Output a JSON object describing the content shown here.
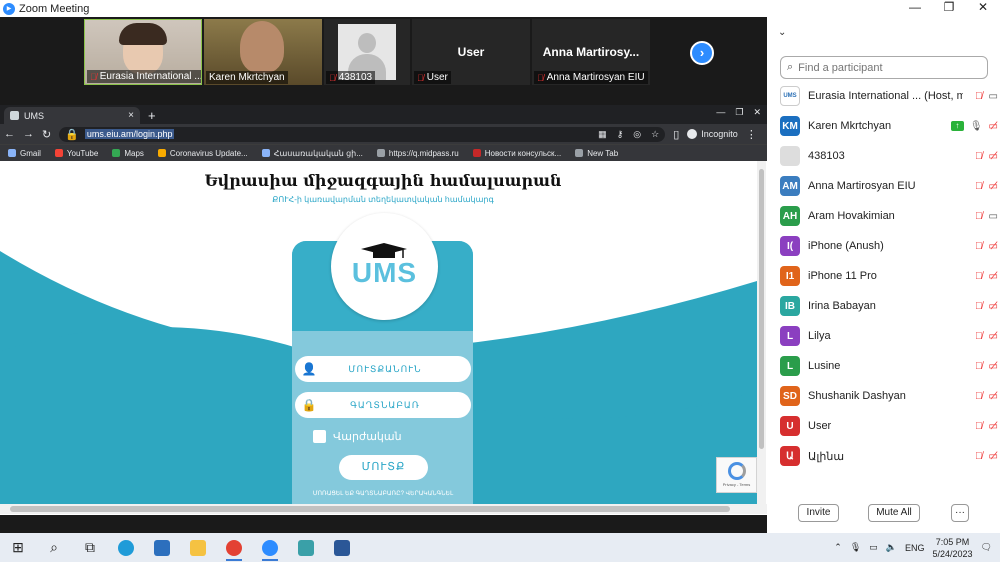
{
  "zoom": {
    "title": "Zoom Meeting",
    "window_controls": [
      "—",
      "❐",
      "✕"
    ]
  },
  "video_tiles": [
    {
      "name": "Eurasia International ..."
    },
    {
      "name": "Karen Mkrtchyan"
    },
    {
      "name": "438103"
    },
    {
      "name": "User",
      "center": "User"
    },
    {
      "name": "Anna Martirosyan EIU",
      "center": "Anna Martirosy..."
    }
  ],
  "video_next": "›",
  "browser": {
    "tab_title": "UMS",
    "tab_close": "×",
    "new_tab": "+",
    "url": "ums.eiu.am/login.php",
    "incognito": "Incognito",
    "bookmarks": [
      "Gmail",
      "YouTube",
      "Maps",
      "Coronavirus Update...",
      "Հասառակական ցի...",
      "https://q.midpass.ru",
      "Новости консульск...",
      "New Tab"
    ]
  },
  "page": {
    "title": "Եվրասիա միջազգային համալսարան",
    "subtitle": "ՔՈՒՀ-ի կառավարման տեղեկատվական համակարգ",
    "logo_text": "UMS",
    "login_placeholder": "ՄՈՒՏՔԱՆՈՒՆ",
    "password_placeholder": "ԳԱՂՏՆԱԲԱՌ",
    "remember_label": "Վարժական",
    "login_button": "ՄՈՒՏՔ",
    "forgot_text": "ՄՈՌԱՑԵԼ ԵՔ ԳԱՂՏՆԱԲԱՌԸ? ՎԵՐԱԿԱՆԳՆԵԼ",
    "recaptcha_text": "Privacy - Terms"
  },
  "panel": {
    "search_placeholder": "Find a participant",
    "participants": [
      {
        "initials": "",
        "name": "Eurasia International ... (Host, me)",
        "color": "#ffffff",
        "icons": [
          "mic-off",
          "video"
        ]
      },
      {
        "initials": "KM",
        "name": "Karen Mkrtchyan",
        "color": "#1b6fc0",
        "icons": [
          "share",
          "mic",
          "video-off"
        ]
      },
      {
        "initials": "",
        "name": "438103",
        "color": "#dddddd",
        "icons": [
          "mic-off",
          "video-off"
        ]
      },
      {
        "initials": "AM",
        "name": "Anna Martirosyan EIU",
        "color": "#3b7dbf",
        "icons": [
          "mic-off",
          "video-off"
        ]
      },
      {
        "initials": "AH",
        "name": "Aram Hovakimian",
        "color": "#2a9d4b",
        "icons": [
          "mic-off",
          "video"
        ]
      },
      {
        "initials": "I(",
        "name": "iPhone (Anush)",
        "color": "#8b3fc0",
        "icons": [
          "mic-off",
          "video-off"
        ]
      },
      {
        "initials": "I1",
        "name": "iPhone 11 Pro",
        "color": "#e0641b",
        "icons": [
          "mic-off",
          "video-off"
        ]
      },
      {
        "initials": "IB",
        "name": "Irina Babayan",
        "color": "#2aa7a0",
        "icons": [
          "mic-off",
          "video-off"
        ]
      },
      {
        "initials": "L",
        "name": "Lilya",
        "color": "#8b3fc0",
        "icons": [
          "mic-off",
          "video-off"
        ]
      },
      {
        "initials": "L",
        "name": "Lusine",
        "color": "#2a9d4b",
        "icons": [
          "mic-off",
          "video-off"
        ]
      },
      {
        "initials": "SD",
        "name": "Shushanik Dashyan",
        "color": "#e0641b",
        "icons": [
          "mic-off",
          "video-off"
        ]
      },
      {
        "initials": "U",
        "name": "User",
        "color": "#d62f2f",
        "icons": [
          "mic-off",
          "video-off"
        ]
      },
      {
        "initials": "Ա",
        "name": "Ալինա",
        "color": "#d62f2f",
        "icons": [
          "mic-off",
          "video-off"
        ]
      }
    ],
    "invite": "Invite",
    "mute_all": "Mute All",
    "more": "···"
  },
  "taskbar": {
    "language": "ENG",
    "time": "7:05 PM",
    "date": "5/24/2023"
  }
}
